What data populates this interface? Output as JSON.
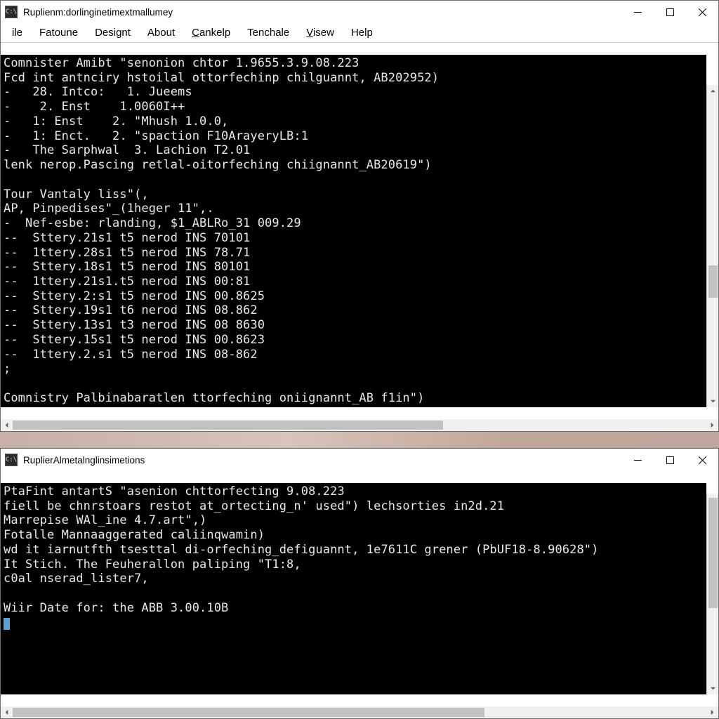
{
  "window_top": {
    "icon_text": "C:\\",
    "title": "Ruplienm:dorlinginetimextmallumey",
    "menu": [
      {
        "label": "ile",
        "accel": ""
      },
      {
        "label": "Fatoune",
        "accel": ""
      },
      {
        "label": "Designt",
        "accel": ""
      },
      {
        "label": "About",
        "accel": ""
      },
      {
        "label": "Cankelp",
        "accel": "C"
      },
      {
        "label": "Tenchale",
        "accel": ""
      },
      {
        "label": "Visew",
        "accel": "V"
      },
      {
        "label": "Help",
        "accel": ""
      }
    ],
    "console_lines": [
      "Comnister Amibt \"senonion chtor 1.9655.3.9.08.223",
      "Fcd int antnciry hstoilal ottorfechinp chilguannt, AB202952)",
      "-   28. Intco:   1. Jueems",
      "-    2. Enst    1.0060I++",
      "-   1: Enst    2. \"Mhush 1.0.0,",
      "-   1: Enct.   2. \"spaction F10ArayeryLB:1",
      "-   The Sarphwal  3. Lachion T2.01",
      "lenk nerop.Pascing retlal-oitorfeching chiignannt_AB20619\")",
      "",
      "Tour Vantaly liss\"(,",
      "AP, Pinpedises\"_(1heger 11\",.",
      "-  Nef-esbe: rlanding, $1_ABLRo_31 009.29",
      "--  Sttery.21s1 t5 nerod INS 70101",
      "--  1ttery.28s1 t5 nerod INS 78.71",
      "--  Sttery.18s1 t5 nerod INS 80101",
      "--  1ttery.21s1.t5 nerod INS 00:81",
      "--  Sttery.2:s1 t5 nerod INS 00.8625",
      "--  Sttery.19s1 t6 nerod INS 08.862",
      "--  Sttery.13s1 t3 nerod INS 08 8630",
      "--  Sttery.15s1 t5 nerod INS 00.8623",
      "--  1ttery.2.s1 t5 nerod INS 08-862",
      ";",
      "",
      "Comnistry Palbinabaratlen ttorfeching oniignannt_AB f1in\")",
      "",
      "",
      ""
    ],
    "hscroll": {
      "thumb_left_pct": 0,
      "thumb_width_pct": 62
    },
    "vscroll": {
      "thumb_top_pct": 56,
      "thumb_height_pct": 10
    }
  },
  "window_bottom": {
    "icon_text": "C:\\",
    "title": "RuplierAlmetalnglinsimetions",
    "console_lines": [
      "PtaFint antartS \"asenion chttorfecting 9.08.223",
      "fiell be chnrstoars restot at_ortecting_n' used\") lechsorties in2d.21",
      "Marrepise WAl_ine 4.7.art\",)",
      "Fotalle Mannaaggerated caliinqwamin)",
      "wd it iarnutfth tsesttal di-orfeching_defiguannt, 1e7611C grener (PbUF18-8.90628\")",
      "It Stich. The Feuherallon paliping \"T1:8,",
      "c0al nserad_lister7,",
      "",
      "Wiir Date for: the ABB 3.00.10B"
    ],
    "hscroll": {
      "thumb_left_pct": 0,
      "thumb_width_pct": 68
    },
    "vscroll": {
      "thumb_top_pct": 2,
      "thumb_height_pct": 55
    }
  }
}
